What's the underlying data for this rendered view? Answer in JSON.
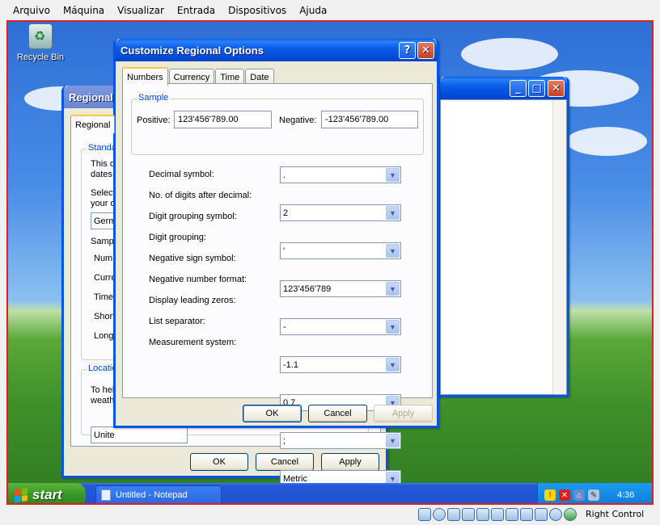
{
  "host_menu": [
    "Arquivo",
    "Máquina",
    "Visualizar",
    "Entrada",
    "Dispositivos",
    "Ajuda"
  ],
  "host_status": {
    "host_key": "Right Control"
  },
  "desktop": {
    "recycle_bin": "Recycle Bin"
  },
  "regional_window": {
    "title": "Regional",
    "tab": "Regional",
    "standards_group": "Standa",
    "desc_1": "This o",
    "desc_2": "dates,",
    "select_1": "Select",
    "select_2": "your o",
    "locale_value": "Germ",
    "samples_label": "Sampl",
    "sample_rows": [
      "Numb",
      "Curren",
      "Time:",
      "Short",
      "Long"
    ],
    "location_group": "Locatio",
    "loc_desc_1": "To hel",
    "loc_desc_2": "weath",
    "location_value": "Unite",
    "ok": "OK",
    "cancel": "Cancel",
    "apply": "Apply"
  },
  "customize": {
    "title": "Customize Regional Options",
    "help_btn": "?",
    "close_btn": "✕",
    "tabs": [
      "Numbers",
      "Currency",
      "Time",
      "Date"
    ],
    "sample_group": "Sample",
    "positive_label": "Positive:",
    "positive_value": "123'456'789.00",
    "negative_label": "Negative:",
    "negative_value": "-123'456'789.00",
    "fields": [
      {
        "label": "Decimal symbol:",
        "value": "."
      },
      {
        "label": "No. of digits after decimal:",
        "value": "2"
      },
      {
        "label": "Digit grouping symbol:",
        "value": "'"
      },
      {
        "label": "Digit grouping:",
        "value": "123'456'789"
      },
      {
        "label": "Negative sign symbol:",
        "value": "-"
      },
      {
        "label": "Negative number format:",
        "value": "-1.1"
      },
      {
        "label": "Display leading zeros:",
        "value": "0.7"
      },
      {
        "label": "List separator:",
        "value": ";"
      },
      {
        "label": "Measurement system:",
        "value": "Metric"
      }
    ],
    "ok": "OK",
    "cancel": "Cancel",
    "apply": "Apply"
  },
  "taskbar": {
    "start_label": "start",
    "task_notepad": "Untitled - Notepad",
    "clock": "4:36"
  },
  "colors": {
    "xp_blue": "#0a54e2",
    "guest_border": "#e02020",
    "start_green": "#3a9628"
  }
}
